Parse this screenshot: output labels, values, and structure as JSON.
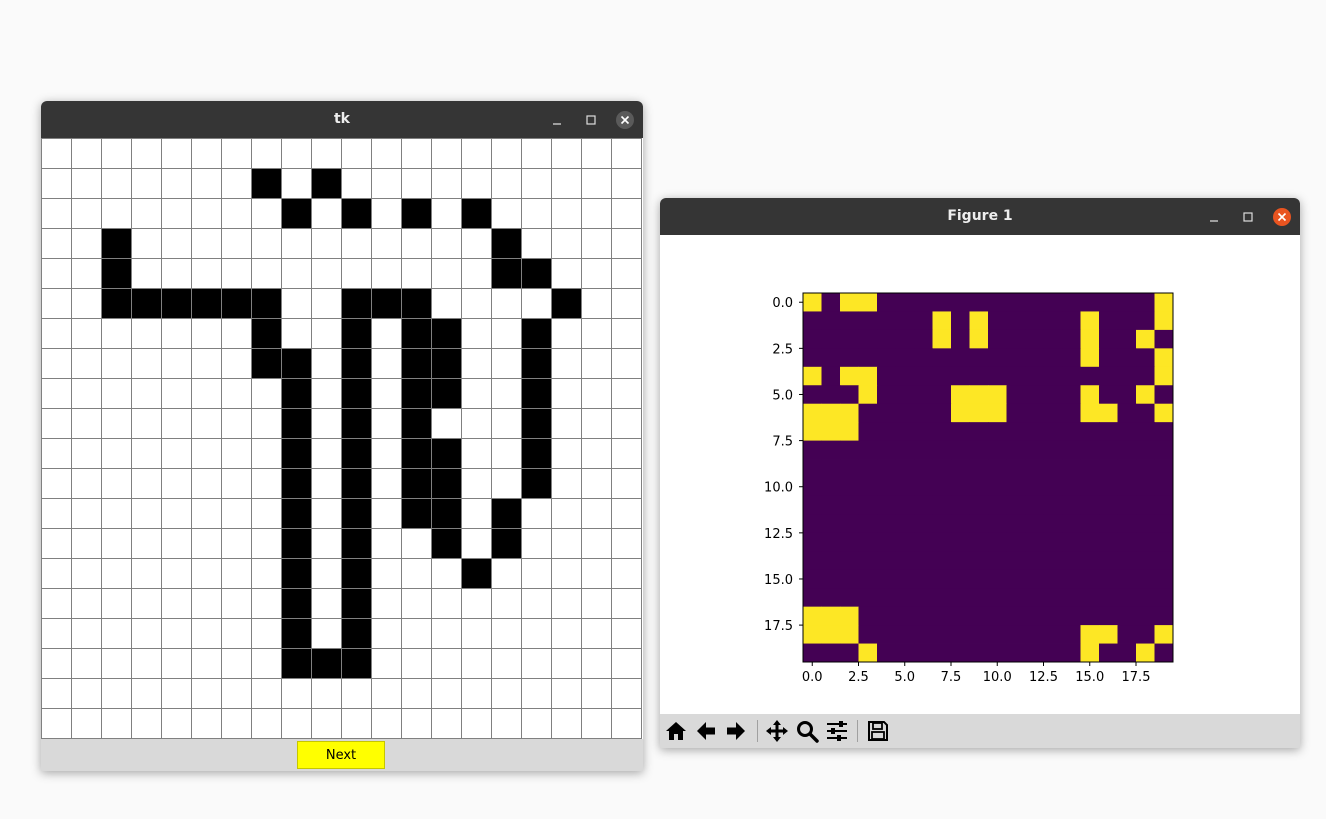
{
  "tk_window": {
    "title": "tk",
    "next_label": "Next",
    "grid": {
      "rows": 20,
      "cols": 20,
      "filled_color": "#000000",
      "empty_color": "#ffffff",
      "line_color": "#808080",
      "filled": [
        [
          1,
          7
        ],
        [
          1,
          9
        ],
        [
          2,
          8
        ],
        [
          2,
          10
        ],
        [
          2,
          12
        ],
        [
          2,
          14
        ],
        [
          3,
          2
        ],
        [
          3,
          15
        ],
        [
          4,
          2
        ],
        [
          4,
          15
        ],
        [
          4,
          16
        ],
        [
          5,
          2
        ],
        [
          5,
          3
        ],
        [
          5,
          4
        ],
        [
          5,
          5
        ],
        [
          5,
          6
        ],
        [
          5,
          7
        ],
        [
          5,
          10
        ],
        [
          5,
          11
        ],
        [
          5,
          12
        ],
        [
          5,
          17
        ],
        [
          6,
          7
        ],
        [
          6,
          10
        ],
        [
          6,
          12
        ],
        [
          6,
          13
        ],
        [
          6,
          16
        ],
        [
          7,
          7
        ],
        [
          7,
          8
        ],
        [
          7,
          10
        ],
        [
          7,
          12
        ],
        [
          7,
          13
        ],
        [
          7,
          16
        ],
        [
          8,
          8
        ],
        [
          8,
          10
        ],
        [
          8,
          12
        ],
        [
          8,
          13
        ],
        [
          8,
          16
        ],
        [
          9,
          8
        ],
        [
          9,
          10
        ],
        [
          9,
          12
        ],
        [
          9,
          16
        ],
        [
          10,
          8
        ],
        [
          10,
          10
        ],
        [
          10,
          12
        ],
        [
          10,
          13
        ],
        [
          10,
          16
        ],
        [
          11,
          8
        ],
        [
          11,
          10
        ],
        [
          11,
          12
        ],
        [
          11,
          13
        ],
        [
          11,
          16
        ],
        [
          12,
          8
        ],
        [
          12,
          10
        ],
        [
          12,
          12
        ],
        [
          12,
          13
        ],
        [
          12,
          15
        ],
        [
          13,
          8
        ],
        [
          13,
          10
        ],
        [
          13,
          13
        ],
        [
          13,
          15
        ],
        [
          14,
          8
        ],
        [
          14,
          10
        ],
        [
          14,
          14
        ],
        [
          15,
          8
        ],
        [
          15,
          10
        ],
        [
          16,
          8
        ],
        [
          16,
          10
        ],
        [
          17,
          8
        ],
        [
          17,
          9
        ],
        [
          17,
          10
        ]
      ]
    }
  },
  "figure_window": {
    "title": "Figure 1",
    "toolbar": {
      "home": "home-icon",
      "back": "arrow-left-icon",
      "forward": "arrow-right-icon",
      "pan": "pan-icon",
      "zoom": "zoom-icon",
      "configure": "sliders-icon",
      "save": "save-icon"
    }
  },
  "chart_data": {
    "type": "heatmap",
    "title": "",
    "xlabel": "",
    "ylabel": "",
    "shape": [
      20,
      20
    ],
    "xlim": [
      -0.5,
      19.5
    ],
    "ylim": [
      19.5,
      -0.5
    ],
    "colormap": {
      "low": "#440154",
      "high": "#fde725"
    },
    "xticks": [
      "0.0",
      "2.5",
      "5.0",
      "7.5",
      "10.0",
      "12.5",
      "15.0",
      "17.5"
    ],
    "yticks": [
      "0.0",
      "2.5",
      "5.0",
      "7.5",
      "10.0",
      "12.5",
      "15.0",
      "17.5"
    ],
    "high_cells": [
      [
        0,
        0
      ],
      [
        0,
        2
      ],
      [
        0,
        3
      ],
      [
        0,
        19
      ],
      [
        1,
        7
      ],
      [
        1,
        9
      ],
      [
        1,
        15
      ],
      [
        1,
        19
      ],
      [
        2,
        7
      ],
      [
        2,
        9
      ],
      [
        2,
        15
      ],
      [
        2,
        18
      ],
      [
        3,
        15
      ],
      [
        3,
        19
      ],
      [
        4,
        0
      ],
      [
        4,
        2
      ],
      [
        4,
        3
      ],
      [
        4,
        19
      ],
      [
        5,
        3
      ],
      [
        5,
        8
      ],
      [
        5,
        9
      ],
      [
        5,
        10
      ],
      [
        5,
        15
      ],
      [
        5,
        18
      ],
      [
        6,
        0
      ],
      [
        6,
        1
      ],
      [
        6,
        2
      ],
      [
        6,
        8
      ],
      [
        6,
        9
      ],
      [
        6,
        10
      ],
      [
        6,
        15
      ],
      [
        6,
        16
      ],
      [
        6,
        19
      ],
      [
        7,
        0
      ],
      [
        7,
        1
      ],
      [
        7,
        2
      ],
      [
        17,
        0
      ],
      [
        17,
        1
      ],
      [
        17,
        2
      ],
      [
        18,
        0
      ],
      [
        18,
        1
      ],
      [
        18,
        2
      ],
      [
        18,
        15
      ],
      [
        18,
        16
      ],
      [
        18,
        19
      ],
      [
        19,
        3
      ],
      [
        19,
        15
      ],
      [
        19,
        18
      ]
    ]
  }
}
